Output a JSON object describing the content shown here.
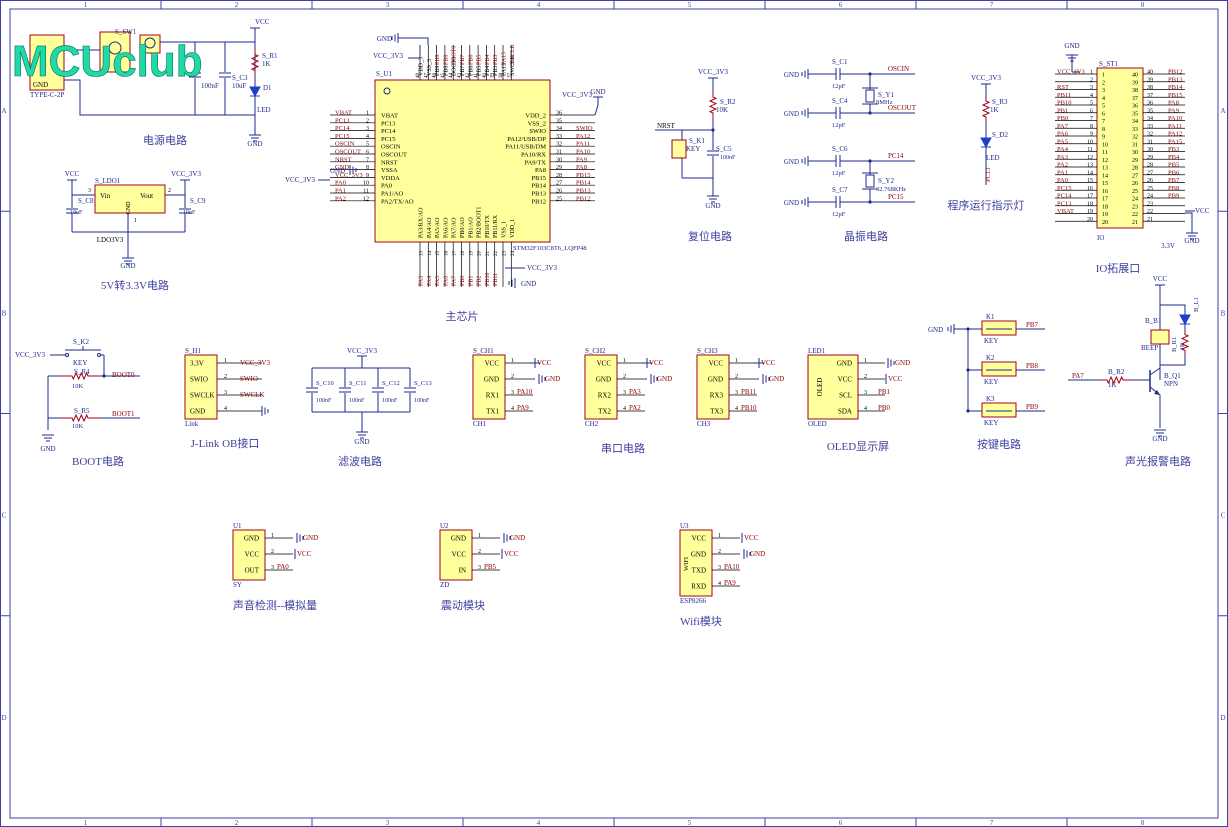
{
  "logo": {
    "text": "MCUclub"
  },
  "frame": {
    "cols": [
      "1",
      "2",
      "3",
      "4",
      "5",
      "6",
      "7",
      "8"
    ],
    "rows": [
      "A",
      "B",
      "C",
      "D"
    ]
  },
  "sections": {
    "power": "电源电路",
    "ldo": "5V转3.3V电路",
    "mcu": "主芯片",
    "reset": "复位电路",
    "crystal": "晶振电路",
    "run_led": "程序运行指示灯",
    "io": "IO拓展口",
    "boot": "BOOT电路",
    "jlink": "J-Link OB接口",
    "filter": "滤波电路",
    "uart": "串口电路",
    "oled": "OLED显示屏",
    "keys": "按键电路",
    "alarm": "声光报警电路",
    "sound": "声音检测--模拟量",
    "vib": "震动模块",
    "wifi": "Wifi模块"
  },
  "power": {
    "usb_label": "TYPE-C-2P",
    "usb_gnd": "GND",
    "sw_ref": "S_SW1",
    "r1_ref": "S_R1",
    "r1_val": "1K",
    "d1_ref": "D1",
    "d1_val": "LED",
    "c3_ref": "S_C3",
    "c3_val": "10uF",
    "c_val": "100nF",
    "vcc": "VCC",
    "gnd": "GND"
  },
  "ldo": {
    "ref": "S_LDO1",
    "vin": "Vin",
    "vout": "Vout",
    "gnd": "GND",
    "part": "LDO3V3",
    "c8_ref": "S_C8",
    "c9_ref": "S_C9",
    "c_val": "10uF",
    "vcc": "VCC",
    "vcc3": "VCC_3V3",
    "p1": "1",
    "p2": "2",
    "p3": "3"
  },
  "mcu": {
    "ref": "S_U1",
    "part": "STM32F103C8T6_LQFP48",
    "left_pins": [
      {
        "num": "1",
        "name": "VBAT",
        "net": "VBAT"
      },
      {
        "num": "2",
        "name": "PC13",
        "net": "PC13"
      },
      {
        "num": "3",
        "name": "PC14",
        "net": "PC14"
      },
      {
        "num": "4",
        "name": "PC15",
        "net": "PC15"
      },
      {
        "num": "5",
        "name": "OSCIN",
        "net": "OSCIN"
      },
      {
        "num": "6",
        "name": "OSCOUT",
        "net": "OSCOUT"
      },
      {
        "num": "7",
        "name": "NRST",
        "net": "NRST"
      },
      {
        "num": "8",
        "name": "VSSA",
        "net": "GND"
      },
      {
        "num": "9",
        "name": "VDDA",
        "net": "VCC_3V3"
      },
      {
        "num": "10",
        "name": "PA0",
        "net": "PA0"
      },
      {
        "num": "11",
        "name": "PA1/AO",
        "net": "PA1"
      },
      {
        "num": "12",
        "name": "PA2/TX/AO",
        "net": "PA2"
      }
    ],
    "right_pins": [
      {
        "num": "36",
        "name": "VDD_2",
        "net": ""
      },
      {
        "num": "35",
        "name": "VSS_2",
        "net": ""
      },
      {
        "num": "34",
        "name": "SWIO",
        "net": "SWIO"
      },
      {
        "num": "33",
        "name": "PA12/USB/DP",
        "net": "PA12"
      },
      {
        "num": "32",
        "name": "PA11/USB/DM",
        "net": "PA11"
      },
      {
        "num": "31",
        "name": "PA10/RX",
        "net": "PA10"
      },
      {
        "num": "30",
        "name": "PA9/TX",
        "net": "PA9"
      },
      {
        "num": "29",
        "name": "PA8",
        "net": "PA8"
      },
      {
        "num": "28",
        "name": "PB15",
        "net": "PB15"
      },
      {
        "num": "27",
        "name": "PB14",
        "net": "PB14"
      },
      {
        "num": "26",
        "name": "PB13",
        "net": "PB13"
      },
      {
        "num": "25",
        "name": "PB12",
        "net": "PB12"
      }
    ],
    "top_pins": [
      {
        "num": "48",
        "name": "VDD_3",
        "net": ""
      },
      {
        "num": "47",
        "name": "VSS_3",
        "net": ""
      },
      {
        "num": "46",
        "name": "PB9",
        "net": "PB9"
      },
      {
        "num": "45",
        "name": "PB8",
        "net": "PB8"
      },
      {
        "num": "44",
        "name": "BOOT0",
        "net": "BOOT0"
      },
      {
        "num": "43",
        "name": "PB7",
        "net": "PB7"
      },
      {
        "num": "42",
        "name": "PB6",
        "net": "PB6"
      },
      {
        "num": "41",
        "name": "PB5",
        "net": "PB5"
      },
      {
        "num": "40",
        "name": "PB4",
        "net": "PB4"
      },
      {
        "num": "39",
        "name": "PB3",
        "net": "PB3"
      },
      {
        "num": "38",
        "name": "PA15",
        "net": "PA15"
      },
      {
        "num": "37",
        "name": "SWCLK",
        "net": "SWCLK"
      }
    ],
    "bottom_pins": [
      {
        "num": "13",
        "name": "PA3/RX/AO",
        "net": "PA3"
      },
      {
        "num": "14",
        "name": "PA4/AO",
        "net": "PA4"
      },
      {
        "num": "15",
        "name": "PA5/AO",
        "net": "PA5"
      },
      {
        "num": "16",
        "name": "PA6/AO",
        "net": "PA6"
      },
      {
        "num": "17",
        "name": "PA7/AO",
        "net": "PA7"
      },
      {
        "num": "18",
        "name": "PB0/AO",
        "net": "PB0"
      },
      {
        "num": "19",
        "name": "PB1/AO",
        "net": "PB1"
      },
      {
        "num": "20",
        "name": "PB2/BOOT1",
        "net": "PB2"
      },
      {
        "num": "21",
        "name": "PB10/TX",
        "net": "PB10"
      },
      {
        "num": "22",
        "name": "PB11/RX",
        "net": "PB11"
      },
      {
        "num": "23",
        "name": "VSS_1",
        "net": ""
      },
      {
        "num": "24",
        "name": "VDD_1",
        "net": ""
      }
    ],
    "gnd": "GND",
    "vcc3": "VCC_3V3"
  },
  "reset": {
    "vcc3": "VCC_3V3",
    "r_ref": "S_R2",
    "r_val": "10K",
    "nrst": "NRST",
    "k_ref": "S_K1",
    "k_val": "KEY",
    "c_ref": "S_C5",
    "c_val": "100nF",
    "gnd": "GND"
  },
  "crystal": {
    "c1": "S_C1",
    "c4": "S_C4",
    "c6": "S_C6",
    "c7": "S_C7",
    "cval": "12pF",
    "y1": "S_Y1",
    "y1_val": "8MHz",
    "y2": "S_Y2",
    "y2_val": "32.768KHz",
    "oscin": "OSCIN",
    "oscout": "OSCOUT",
    "pc14": "PC14",
    "pc15": "PC15",
    "gnd": "GND"
  },
  "run_led": {
    "vcc3": "VCC_3V3",
    "r_ref": "S_R3",
    "r_val": "1K",
    "d_ref": "S_D2",
    "d_val": "LED",
    "net": "PC13"
  },
  "io": {
    "ref": "S_ST1",
    "vcc3": "VCC_3V3",
    "gnd": "GND",
    "vcc": "VCC",
    "part": "IO",
    "v33": "3.3V",
    "left": [
      "VCC_3V3",
      "",
      "RST",
      "PB11",
      "PB10",
      "PB1",
      "PB0",
      "PA7",
      "PA6",
      "PA5",
      "PA4",
      "PA3",
      "PA2",
      "PA1",
      "PA0",
      "PC15",
      "PC14",
      "PC13",
      "VBAT",
      ""
    ],
    "right": [
      "PB12",
      "PB13",
      "PB14",
      "PB15",
      "PA8",
      "PA9",
      "PA10",
      "PA11",
      "PA12",
      "PA15",
      "PB3",
      "PB4",
      "PB5",
      "PB6",
      "PB7",
      "PB8",
      "PB9",
      "",
      "",
      ""
    ]
  },
  "boot": {
    "vcc3": "VCC_3V3",
    "k_ref": "S_K2",
    "k_val": "KEY",
    "r4": "S_R4",
    "r5": "S_R5",
    "r_val": "10K",
    "boot0": "BOOT0",
    "boot1": "BOOT1",
    "gnd": "GND"
  },
  "jlink": {
    "ref": "S_H1",
    "part": "Link",
    "pins": [
      {
        "num": "1",
        "name": "3.3V",
        "net": "VCC_3V3"
      },
      {
        "num": "2",
        "name": "SWIO",
        "net": "SWIO"
      },
      {
        "num": "3",
        "name": "SWCLK",
        "net": "SWCLK"
      },
      {
        "num": "4",
        "name": "GND",
        "net": ""
      }
    ]
  },
  "filter": {
    "vcc3": "VCC_3V3",
    "caps": [
      "S_C10",
      "S_C11",
      "S_C12",
      "S_C13"
    ],
    "cval": "100nF",
    "gnd": "GND"
  },
  "uarts": [
    {
      "ref": "S_CH1",
      "part": "CH1",
      "pins": [
        {
          "num": "1",
          "name": "VCC",
          "net": "VCC"
        },
        {
          "num": "2",
          "name": "GND",
          "net": "GND"
        },
        {
          "num": "3",
          "name": "RX1",
          "net": "PA10"
        },
        {
          "num": "4",
          "name": "TX1",
          "net": "PA9"
        }
      ]
    },
    {
      "ref": "S_CH2",
      "part": "CH2",
      "pins": [
        {
          "num": "1",
          "name": "VCC",
          "net": "VCC"
        },
        {
          "num": "2",
          "name": "GND",
          "net": "GND"
        },
        {
          "num": "3",
          "name": "RX2",
          "net": "PA3"
        },
        {
          "num": "4",
          "name": "TX2",
          "net": "PA2"
        }
      ]
    },
    {
      "ref": "S_CH3",
      "part": "CH3",
      "pins": [
        {
          "num": "1",
          "name": "VCC",
          "net": "VCC"
        },
        {
          "num": "2",
          "name": "GND",
          "net": "GND"
        },
        {
          "num": "3",
          "name": "RX3",
          "net": "PB11"
        },
        {
          "num": "4",
          "name": "TX3",
          "net": "PB10"
        }
      ]
    }
  ],
  "oled": {
    "ref": "LED1",
    "part": "OLED",
    "body": "OLED",
    "pins": [
      {
        "num": "1",
        "name": "GND",
        "net": "GND"
      },
      {
        "num": "2",
        "name": "VCC",
        "net": "VCC"
      },
      {
        "num": "3",
        "name": "SCL",
        "net": "PB1"
      },
      {
        "num": "4",
        "name": "SDA",
        "net": "PB0"
      }
    ]
  },
  "keys": {
    "gnd": "GND",
    "items": [
      {
        "ref": "K1",
        "val": "KEY",
        "net": "PB7"
      },
      {
        "ref": "K2",
        "val": "KEY",
        "net": "PB8"
      },
      {
        "ref": "K3",
        "val": "KEY",
        "net": "PB9"
      }
    ]
  },
  "alarm": {
    "vcc": "VCC",
    "b1": "B_B1",
    "b1_val": "BEEP",
    "l1": "B_L1",
    "r1": "B_R1",
    "r1_val": "1K",
    "r2": "B_R2",
    "r2_val": "1K",
    "q1": "B_Q1",
    "q1_val": "NPN",
    "pa7": "PA7",
    "gnd": "GND"
  },
  "modules": [
    {
      "ref": "U1",
      "part": "SY",
      "pins": [
        {
          "num": "1",
          "name": "GND",
          "net": "GND"
        },
        {
          "num": "2",
          "name": "VCC",
          "net": "VCC"
        },
        {
          "num": "3",
          "name": "OUT",
          "net": "PA0"
        }
      ]
    },
    {
      "ref": "U2",
      "part": "ZD",
      "pins": [
        {
          "num": "1",
          "name": "GND",
          "net": "GND"
        },
        {
          "num": "2",
          "name": "VCC",
          "net": "VCC"
        },
        {
          "num": "3",
          "name": "IN",
          "net": "PB5"
        }
      ]
    },
    {
      "ref": "U3",
      "part": "ESP8266",
      "body": "WIFI",
      "pins": [
        {
          "num": "1",
          "name": "VCC",
          "net": "VCC"
        },
        {
          "num": "2",
          "name": "GND",
          "net": "GND"
        },
        {
          "num": "3",
          "name": "TXD",
          "net": "PA10"
        },
        {
          "num": "4",
          "name": "RXD",
          "net": "PA9"
        }
      ]
    }
  ],
  "colors": {
    "wire": "#1e2a8c",
    "body_fill": "#ffff9c",
    "body_stroke": "#a0001c",
    "ref_text": "#1e2a8c",
    "net_text": "#8b0000",
    "pin_name": "#000000",
    "frame": "#4040a0",
    "logo": "#1fd9a8",
    "led": "#1e3fc8"
  }
}
